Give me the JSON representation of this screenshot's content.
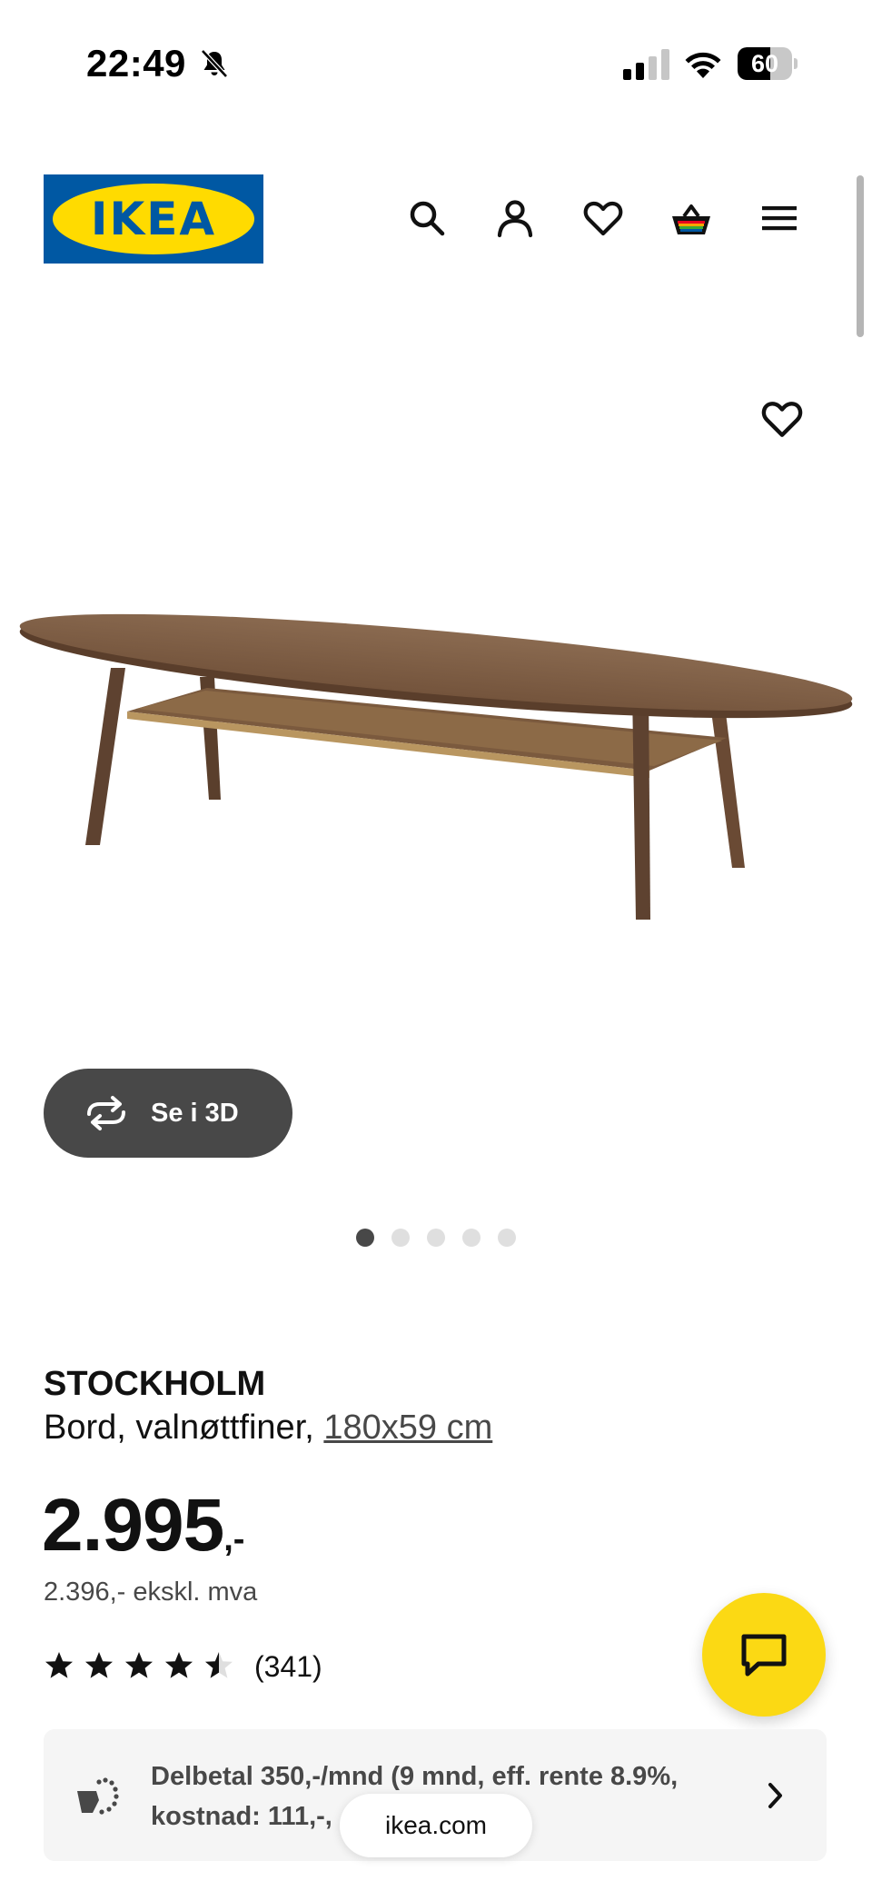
{
  "status_bar": {
    "time": "22:49",
    "battery": "60",
    "battery_level": 0.6
  },
  "header": {
    "logo_text": "IKEA",
    "icons": [
      "search-icon",
      "account-icon",
      "wishlist-icon",
      "basket-icon",
      "menu-icon"
    ]
  },
  "gallery": {
    "view_3d_label": "Se i 3D",
    "image_count": 5,
    "active_index": 0
  },
  "product": {
    "name": "STOCKHOLM",
    "description": "Bord, valnøttfiner,",
    "size": "180x59 cm",
    "price_main": "2.995",
    "price_suffix": ",-",
    "price_ex_vat": "2.396,- ekskl. mva",
    "rating": 4.5,
    "rating_max": 5,
    "review_count": "(341)"
  },
  "installment": {
    "line1": "Delbetal 350,-/mnd (9 mnd, eff. rente 8.9%,",
    "line2": "kostnad: 111,-,"
  },
  "browser": {
    "url": "ikea.com"
  },
  "colors": {
    "brand_blue": "#0058a3",
    "brand_yellow": "#ffdb00",
    "chat_yellow": "#fbd914",
    "dark_gray": "#484848"
  }
}
